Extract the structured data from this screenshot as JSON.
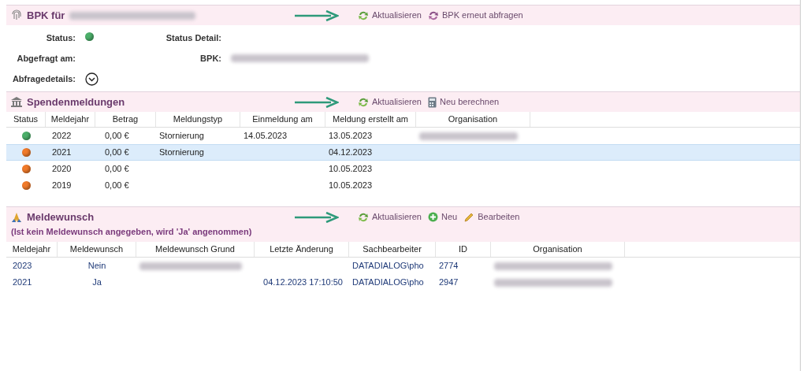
{
  "bpk": {
    "title": "BPK für",
    "title_suffix": {
      "kind": "redacted"
    },
    "actions": [
      {
        "kind": "refresh",
        "label": "Aktualisieren",
        "annotated": true
      },
      {
        "kind": "requery",
        "label": "BPK erneut abfragen",
        "annotated": false
      }
    ],
    "fields": [
      {
        "label": "Status:",
        "kind": "dot",
        "color": "#4caf6a"
      },
      {
        "label": "Status Detail:",
        "kind": "empty"
      },
      {
        "label": "Abgefragt am:",
        "kind": "empty"
      },
      {
        "label": "BPK:",
        "kind": "redacted"
      },
      {
        "label": "Abfragedetails:",
        "kind": "expander"
      }
    ]
  },
  "spenden": {
    "title": "Spendenmeldungen",
    "actions": [
      {
        "kind": "refresh",
        "label": "Aktualisieren",
        "annotated": true
      },
      {
        "kind": "calculator",
        "label": "Neu berechnen",
        "annotated": false
      }
    ],
    "columns": [
      "Status",
      "Meldejahr",
      "Betrag",
      "Meldungstyp",
      "Einmeldung am",
      "Meldung erstellt am",
      "Organisation"
    ],
    "rows": [
      {
        "color": "#4caf6a",
        "selected": false,
        "cells": [
          {
            "kind": "dot"
          },
          "2022",
          "0,00 €",
          "Stornierung",
          "14.05.2023",
          "13.05.2023",
          {
            "kind": "redacted"
          }
        ]
      },
      {
        "color": "#f07a2a",
        "selected": true,
        "cells": [
          {
            "kind": "dot"
          },
          "2021",
          "0,00 €",
          "Stornierung",
          "",
          "04.12.2023",
          ""
        ]
      },
      {
        "color": "#f07a2a",
        "selected": false,
        "cells": [
          {
            "kind": "dot"
          },
          "2020",
          "0,00 €",
          "",
          "",
          "10.05.2023",
          ""
        ]
      },
      {
        "color": "#f07a2a",
        "selected": false,
        "cells": [
          {
            "kind": "dot"
          },
          "2019",
          "0,00 €",
          "",
          "",
          "10.05.2023",
          ""
        ]
      }
    ]
  },
  "meldewunsch": {
    "title": "Meldewunsch",
    "note": "(Ist kein Meldewunsch angegeben, wird 'Ja' angenommen)",
    "actions": [
      {
        "kind": "refresh",
        "label": "Aktualisieren",
        "annotated": true
      },
      {
        "kind": "plus",
        "label": "Neu",
        "annotated": false
      },
      {
        "kind": "pencil",
        "label": "Bearbeiten",
        "annotated": false
      }
    ],
    "columns": [
      "Meldejahr",
      "Meldewunsch",
      "Meldewunsch Grund",
      "Letzte Änderung",
      "Sachbearbeiter",
      "ID",
      "Organisation"
    ],
    "rows": [
      {
        "cells": [
          "2023",
          "Nein",
          {
            "kind": "redacted"
          },
          "",
          "DATADIALOG\\pho",
          "2774",
          {
            "kind": "redacted"
          }
        ]
      },
      {
        "cells": [
          "2021",
          "Ja",
          "",
          "04.12.2023 17:10:50",
          "DATADIALOG\\pho",
          "2947",
          {
            "kind": "redacted"
          }
        ]
      }
    ]
  }
}
